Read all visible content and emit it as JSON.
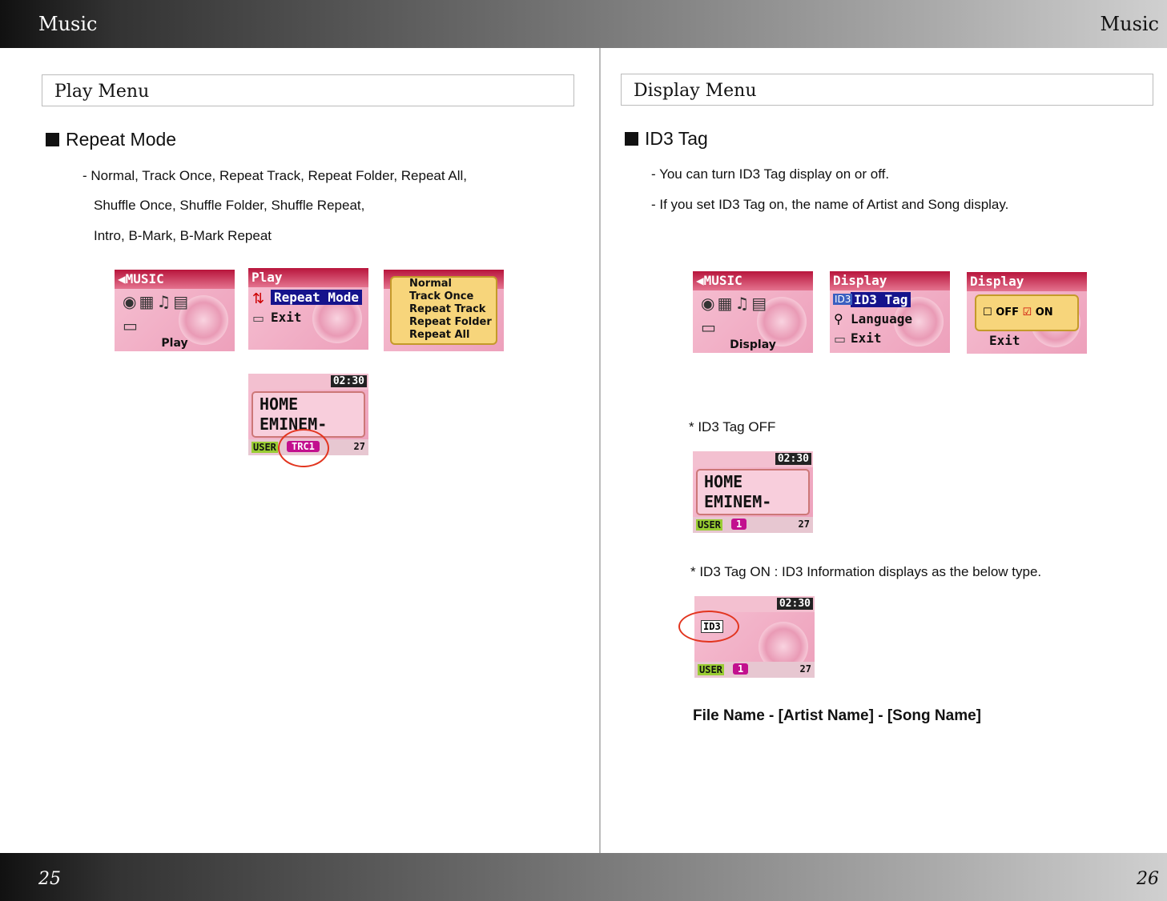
{
  "header": {
    "left": "Music",
    "right": "Music"
  },
  "footer": {
    "left_page": "25",
    "right_page": "26"
  },
  "left": {
    "section_title": "Play Menu",
    "heading": "Repeat Mode",
    "lines": [
      "- Normal, Track Once, Repeat Track, Repeat Folder, Repeat All,",
      "Shuffle Once, Shuffle Folder, Shuffle Repeat,",
      "Intro, B-Mark, B-Mark Repeat"
    ],
    "screens": {
      "music_title": "MUSIC",
      "music_label": "Play",
      "play_title": "Play",
      "play_items": [
        "Repeat Mode",
        "Exit"
      ],
      "options": [
        "Normal",
        "Track Once",
        "Repeat Track",
        "Repeat Folder",
        "Repeat All"
      ],
      "player": {
        "time": "02:30",
        "line1": "HOME",
        "line2": "EMINEM-",
        "user": "USER",
        "mode": "TRC1",
        "volume": "27"
      }
    }
  },
  "right": {
    "section_title": "Display Menu",
    "heading": "ID3 Tag",
    "lines": [
      "- You can turn ID3 Tag display on or off.",
      "- If you set ID3 Tag on, the name of Artist and Song display."
    ],
    "screens": {
      "music_title": "MUSIC",
      "music_label": "Display",
      "display_title": "Display",
      "display_items": [
        "ID3 Tag",
        "Language",
        "Exit"
      ],
      "toggle_title": "Display",
      "toggle_off": "OFF",
      "toggle_on": "ON",
      "toggle_exit": "Exit"
    },
    "off_caption": "* ID3 Tag OFF",
    "on_caption": "* ID3 Tag ON : ID3 Information displays as the below type.",
    "player_off": {
      "time": "02:30",
      "line1": "HOME",
      "line2": "EMINEM-",
      "user": "USER",
      "mode": "1",
      "volume": "27"
    },
    "player_on": {
      "time": "02:30",
      "line1": "ID3",
      "user": "USER",
      "mode": "1",
      "volume": "27"
    },
    "format_line": "File Name - [Artist Name] - [Song Name]"
  }
}
